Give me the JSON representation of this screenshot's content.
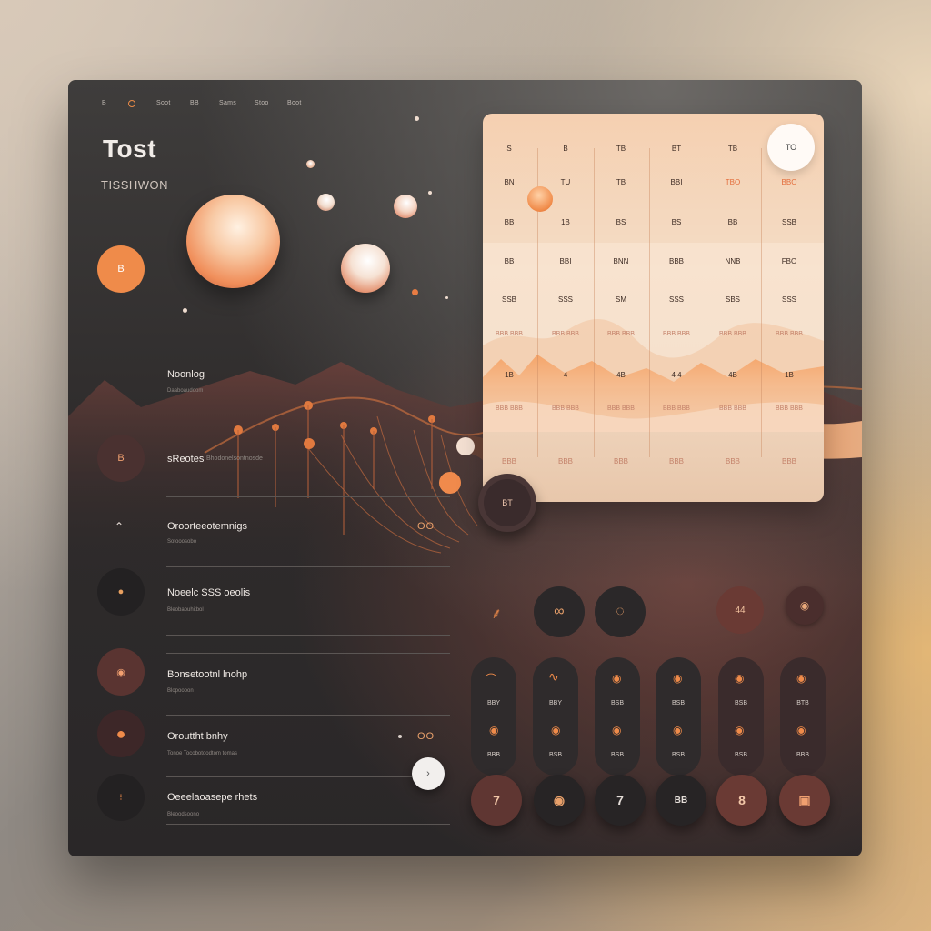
{
  "nav": {
    "items": [
      "B",
      "",
      "Soot",
      "BB",
      "Sams",
      "Stoo",
      "Boot"
    ]
  },
  "header": {
    "title": "Tost",
    "subtitle": "TISSHWON"
  },
  "rows": [
    {
      "label": "Noonlog",
      "sub": "Daaboaudoom"
    },
    {
      "label": "sReotes",
      "sub": "Bhodonelsontnosde",
      "value": ""
    },
    {
      "label": "Oroorteeotemnigs",
      "sub": "Sotooosobo",
      "value": "OO"
    },
    {
      "label": "Noeelc SSS oeolis",
      "sub": "Bleobaouhitbol",
      "value": ""
    },
    {
      "label": "Bonsetootnl lnohp",
      "sub": "Blopoooon",
      "value": ""
    },
    {
      "label": "Orouttht bnhy",
      "sub": "Tonoe Tocobotoodtom tomas",
      "value": "OO"
    },
    {
      "label": "Oeeelaoasepe rhets",
      "sub": "Bleoodsoono",
      "value": ""
    }
  ],
  "left_circles": [
    "B",
    "",
    "8",
    "",
    "8",
    "8"
  ],
  "calendar": {
    "top_button": "TO",
    "rows": [
      [
        "S",
        "B",
        "TB",
        "BT",
        "TB",
        ""
      ],
      [
        "BN",
        "TU",
        "TB",
        "BBI",
        "TBO",
        "BBO"
      ],
      [
        "BB",
        "1B",
        "BS",
        "BS",
        "BB",
        "SSB"
      ],
      [
        "BB",
        "BBI",
        "BNN",
        "BBB",
        "NNB",
        "FBO"
      ],
      [
        "SSB",
        "SSS",
        "SM",
        "SSS",
        "SBS",
        "SSS"
      ],
      [
        "BBB BBB",
        "BBB BBB",
        "BBB BBB",
        "BBB BBB",
        "BBB BBB",
        "BBB BBB"
      ],
      [
        "1B",
        "4",
        "4B",
        "4 4",
        "4B",
        "1B"
      ],
      [
        "BBB BBB",
        "BBB BBB",
        "BBB BBB",
        "BBB BBB",
        "BBB BBB",
        "BBB BBB"
      ],
      [
        "BBB",
        "BBB",
        "BBB",
        "BBB",
        "BBB",
        "BBB"
      ]
    ],
    "floating_button": "BT"
  },
  "controls": {
    "top_icons": [
      "feather-icon",
      "link-icon",
      "circle-icon",
      "44",
      "target-icon"
    ],
    "top_label_4": "44",
    "pill_labels_row1": [
      "BBY",
      "BBY",
      "BSB",
      "BSB",
      "BSB",
      "BTB"
    ],
    "pill_labels_row2": [
      "BBB",
      "BSB",
      "BSB",
      "BSB",
      "BSB",
      "BBB"
    ],
    "bottom_keys": [
      "7",
      "",
      "7",
      "BB",
      "8",
      ""
    ]
  },
  "colors": {
    "accent": "#ee8b4c",
    "rust": "#6a3a34",
    "card": "#2e2b2c"
  }
}
